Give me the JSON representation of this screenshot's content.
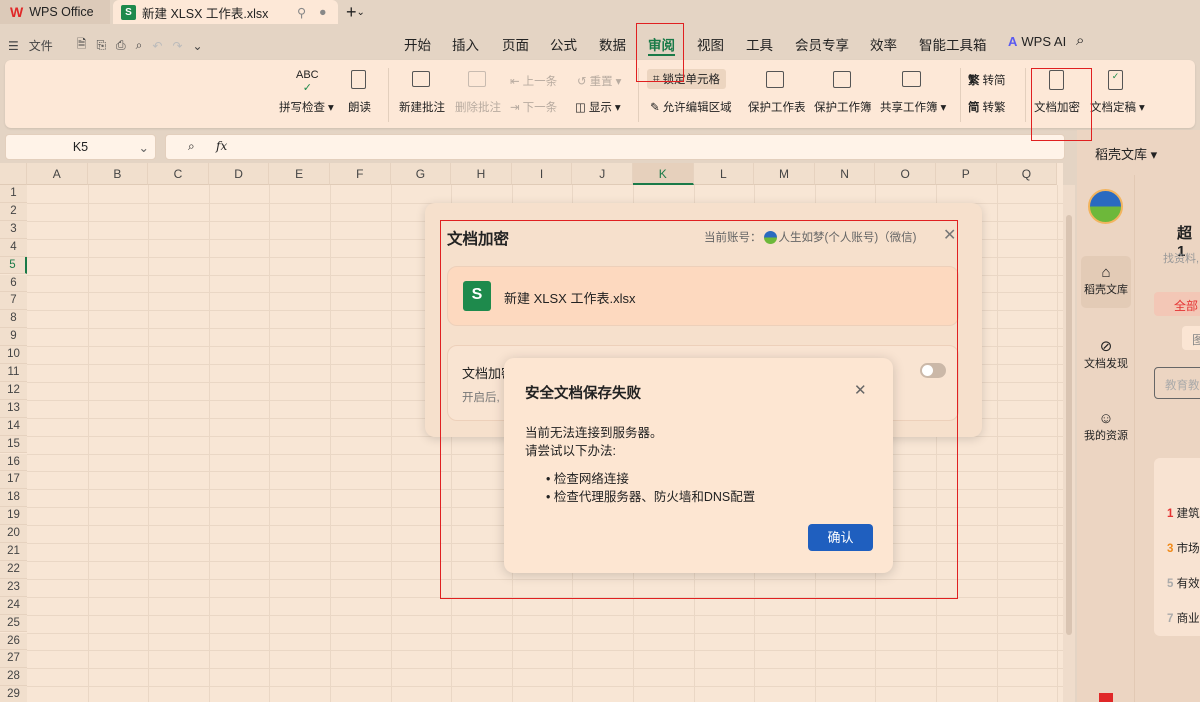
{
  "tabs": {
    "home": "WPS Office",
    "doc": "新建 XLSX 工作表.xlsx"
  },
  "quickbar": {
    "file": "文件"
  },
  "menu": [
    "开始",
    "插入",
    "页面",
    "公式",
    "数据",
    "审阅",
    "视图",
    "工具",
    "会员专享",
    "效率",
    "智能工具箱"
  ],
  "menu_active": "审阅",
  "wps_ai": "WPS AI",
  "ribbon": {
    "spell": "拼写检查",
    "read": "朗读",
    "new_comment": "新建批注",
    "del_comment": "删除批注",
    "prev": "上一条",
    "next": "下一条",
    "reset": "重置",
    "show": "显示",
    "lock_cell": "锁定单元格",
    "allow_edit": "允许编辑区域",
    "protect_sheet": "保护工作表",
    "protect_book": "保护工作簿",
    "share_book": "共享工作簿",
    "to_simp": "转简",
    "to_trad": "转繁",
    "encrypt": "文档加密",
    "finalize": "文档定稿",
    "abc": "ABC",
    "fan": "繁",
    "jian": "简"
  },
  "formula": {
    "cell": "K5",
    "fx": "fx"
  },
  "columns": [
    "A",
    "B",
    "C",
    "D",
    "E",
    "F",
    "G",
    "H",
    "I",
    "J",
    "K",
    "L",
    "M",
    "N",
    "O",
    "P",
    "Q"
  ],
  "rows": 29,
  "active_col": "K",
  "active_row": 5,
  "sidebar": {
    "title": "稻壳文库",
    "nav": [
      "稻壳文库",
      "文档发现",
      "我的资源"
    ],
    "heading": "超1",
    "sub": "找资料,",
    "chip": "全部",
    "chip2": "图",
    "search_ph": "教育教",
    "list": [
      {
        "n": "1",
        "t": "建筑"
      },
      {
        "n": "3",
        "t": "市场"
      },
      {
        "n": "5",
        "t": "有效"
      },
      {
        "n": "7",
        "t": "商业"
      }
    ]
  },
  "encrypt_dialog": {
    "title": "文档加密",
    "account_label": "当前账号：",
    "account": "人生如梦(个人账号)（微信)",
    "file": "新建 XLSX 工作表.xlsx",
    "option": "文档加密",
    "option_desc": "开启后,"
  },
  "alert": {
    "title": "安全文档保存失败",
    "line1": "当前无法连接到服务器。",
    "line2": "请尝试以下办法:",
    "bullets": [
      "检查网络连接",
      "检查代理服务器、防火墙和DNS配置"
    ],
    "ok": "确认"
  }
}
